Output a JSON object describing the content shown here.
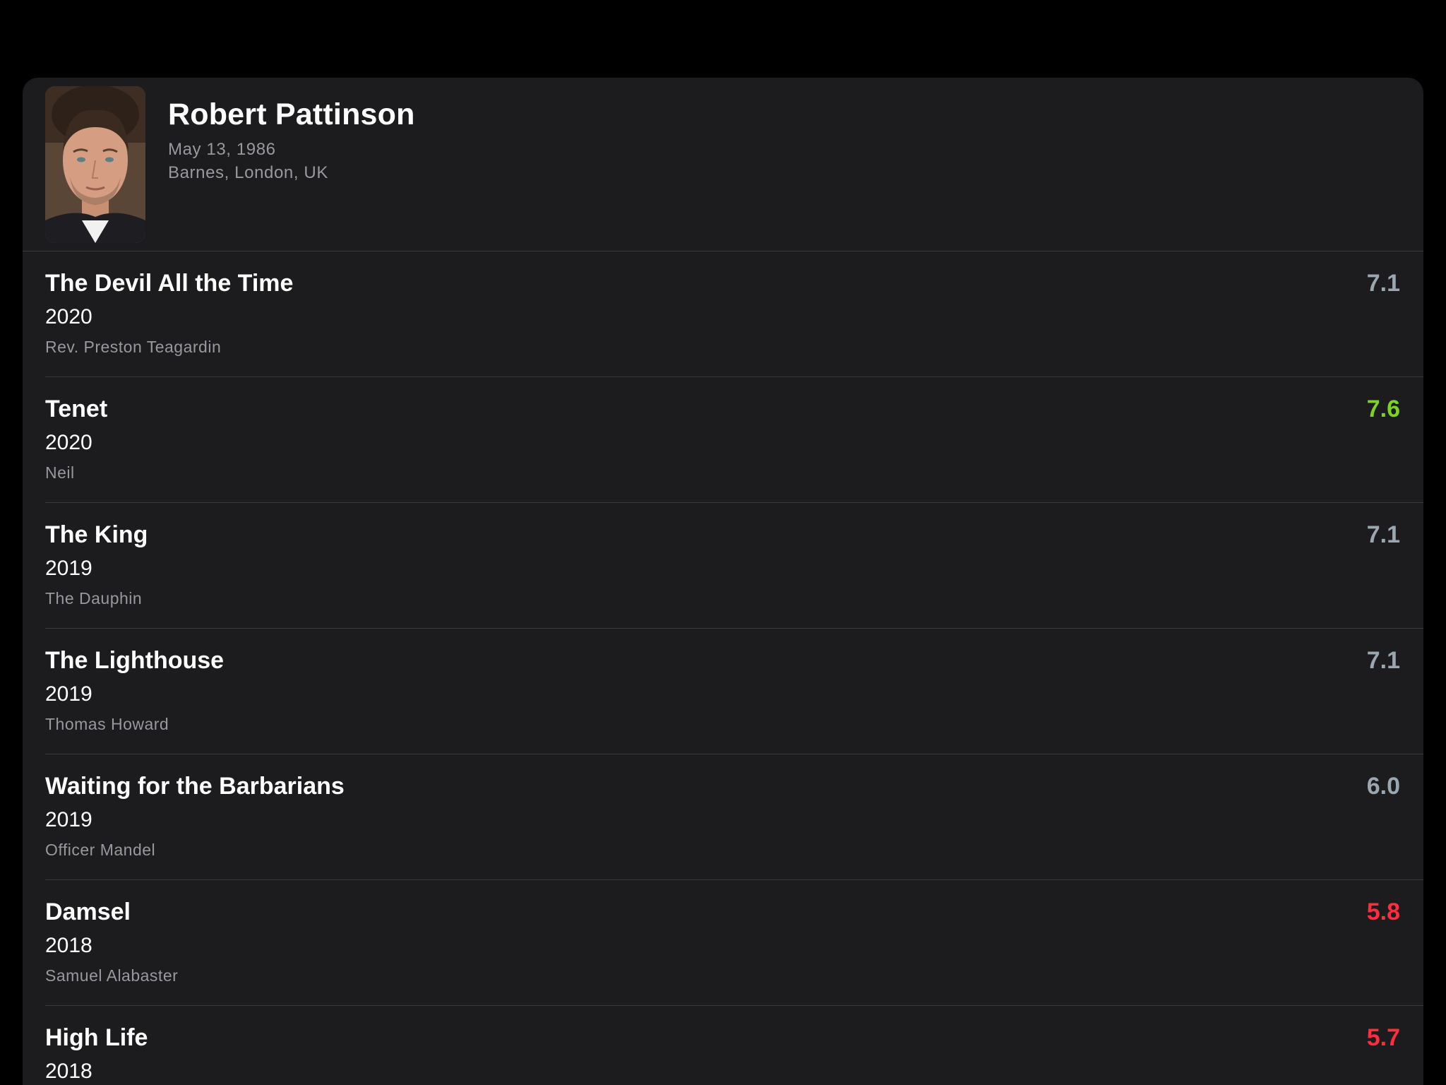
{
  "person": {
    "name": "Robert Pattinson",
    "birth_date": "May 13, 1986",
    "birth_place": "Barnes, London, UK"
  },
  "colors": {
    "background": "#000000",
    "panel": "#1c1c1e",
    "divider": "#38383a",
    "secondary_text": "#98989d",
    "rating_neutral": "#9aa7b0",
    "rating_good": "#7ed321",
    "rating_bad": "#ff2d3d"
  },
  "credits": [
    {
      "title": "The Devil All the Time",
      "year": "2020",
      "role": "Rev. Preston Teagardin",
      "rating": "7.1",
      "rating_color": "#9aa7b0"
    },
    {
      "title": "Tenet",
      "year": "2020",
      "role": "Neil",
      "rating": "7.6",
      "rating_color": "#7ed321"
    },
    {
      "title": "The King",
      "year": "2019",
      "role": "The Dauphin",
      "rating": "7.1",
      "rating_color": "#9aa7b0"
    },
    {
      "title": "The Lighthouse",
      "year": "2019",
      "role": "Thomas Howard",
      "rating": "7.1",
      "rating_color": "#9aa7b0"
    },
    {
      "title": "Waiting for the Barbarians",
      "year": "2019",
      "role": "Officer Mandel",
      "rating": "6.0",
      "rating_color": "#9aa7b0"
    },
    {
      "title": "Damsel",
      "year": "2018",
      "role": "Samuel Alabaster",
      "rating": "5.8",
      "rating_color": "#ff2d3d"
    },
    {
      "title": "High Life",
      "year": "2018",
      "role": "",
      "rating": "5.7",
      "rating_color": "#ff2d3d"
    }
  ]
}
